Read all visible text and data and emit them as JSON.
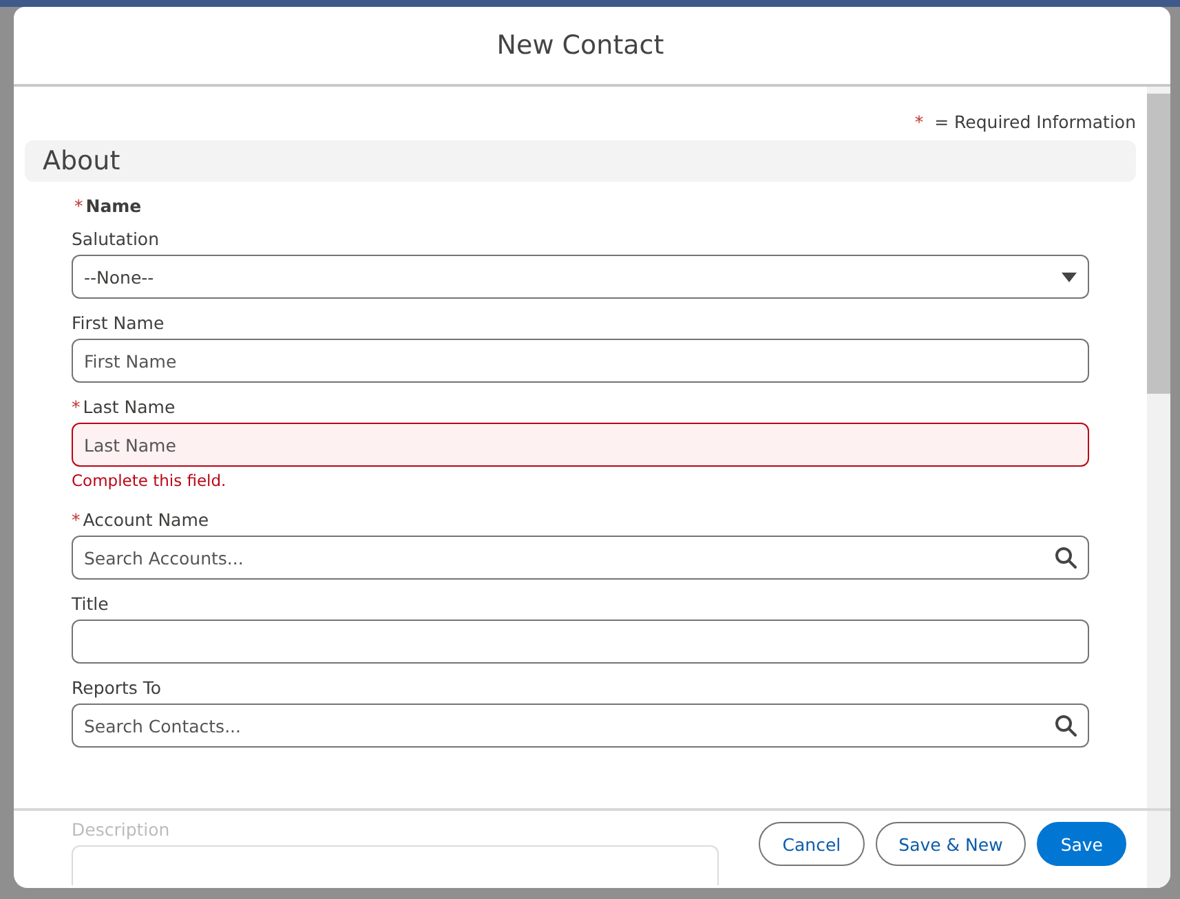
{
  "modal": {
    "title": "New Contact",
    "required_note": {
      "mark": "*",
      "text": "= Required Information"
    }
  },
  "section": {
    "title": "About"
  },
  "name_group": {
    "label": "Name",
    "required": true
  },
  "fields": [
    {
      "kind": "select",
      "label": "Salutation",
      "required": false,
      "value": "--None--"
    },
    {
      "kind": "text",
      "label": "First Name",
      "required": false,
      "placeholder": "First Name"
    },
    {
      "kind": "text",
      "label": "Last Name",
      "required": true,
      "placeholder": "Last Name",
      "error": "Complete this field."
    },
    {
      "kind": "search",
      "label": "Account Name",
      "required": true,
      "placeholder": "Search Accounts..."
    },
    {
      "kind": "text",
      "label": "Title",
      "required": false
    },
    {
      "kind": "search",
      "label": "Reports To",
      "required": false,
      "placeholder": "Search Contacts..."
    },
    {
      "kind": "textarea",
      "label": "Description",
      "required": false
    }
  ],
  "buttons": [
    {
      "label": "Cancel",
      "kind": "neutral"
    },
    {
      "label": "Save & New",
      "kind": "neutral"
    },
    {
      "label": "Save",
      "kind": "brand"
    }
  ]
}
